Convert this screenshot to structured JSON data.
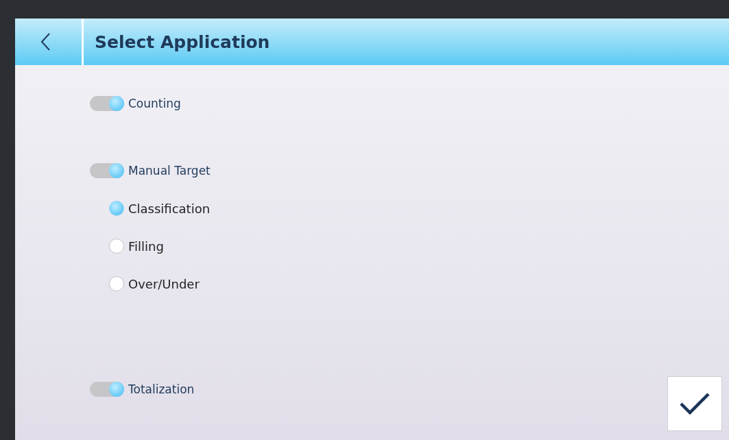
{
  "header": {
    "title": "Select Application"
  },
  "applications": [
    {
      "kind": "toggle",
      "label": "Counting",
      "on": true
    },
    {
      "kind": "toggle",
      "label": "Manual Target",
      "on": true,
      "children": [
        {
          "kind": "radio",
          "label": "Classification",
          "selected": true
        },
        {
          "kind": "radio",
          "label": "Filling",
          "selected": false
        },
        {
          "kind": "radio",
          "label": "Over/Under",
          "selected": false
        }
      ]
    },
    {
      "kind": "toggle",
      "label": "Totalization",
      "on": true
    }
  ],
  "confirm": {
    "kind": "check"
  }
}
